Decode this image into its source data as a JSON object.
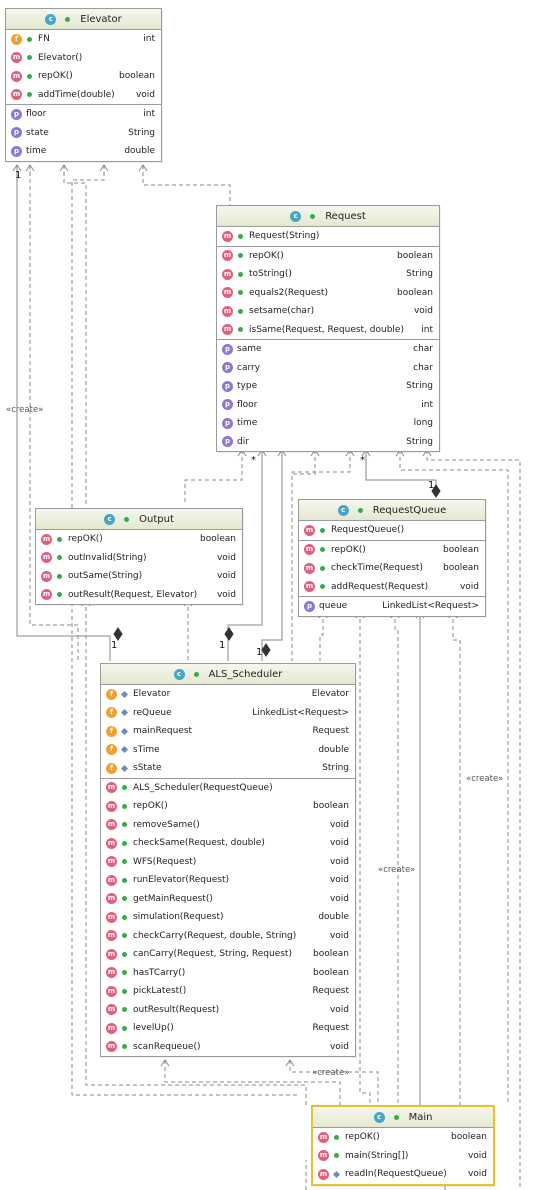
{
  "classes": {
    "elevator": {
      "name": "Elevator",
      "methods": [
        {
          "name": "FN",
          "type": "int",
          "badge": "f",
          "vis": "pub"
        },
        {
          "name": "Elevator()",
          "type": "",
          "badge": "m",
          "vis": "pub"
        },
        {
          "name": "repOK()",
          "type": "boolean",
          "badge": "m",
          "vis": "pub"
        },
        {
          "name": "addTime(double)",
          "type": "void",
          "badge": "m",
          "vis": "pub"
        }
      ],
      "fields": [
        {
          "name": "floor",
          "type": "int",
          "badge": "p",
          "vis": "pub"
        },
        {
          "name": "state",
          "type": "String",
          "badge": "p",
          "vis": "pub"
        },
        {
          "name": "time",
          "type": "double",
          "badge": "p",
          "vis": "pub"
        }
      ]
    },
    "request": {
      "name": "Request",
      "constructors": [
        {
          "name": "Request(String)",
          "type": "",
          "badge": "m",
          "vis": "pub"
        }
      ],
      "methods": [
        {
          "name": "repOK()",
          "type": "boolean",
          "badge": "m",
          "vis": "pub"
        },
        {
          "name": "toString()",
          "type": "String",
          "badge": "m",
          "vis": "pub"
        },
        {
          "name": "equals2(Request)",
          "type": "boolean",
          "badge": "m",
          "vis": "pub"
        },
        {
          "name": "setsame(char)",
          "type": "void",
          "badge": "m",
          "vis": "pub"
        },
        {
          "name": "isSame(Request, Request, double)",
          "type": "int",
          "badge": "m",
          "vis": "pub"
        }
      ],
      "fields": [
        {
          "name": "same",
          "type": "char",
          "badge": "p",
          "vis": "pub"
        },
        {
          "name": "carry",
          "type": "char",
          "badge": "p",
          "vis": "pub"
        },
        {
          "name": "type",
          "type": "String",
          "badge": "p",
          "vis": "pub"
        },
        {
          "name": "floor",
          "type": "int",
          "badge": "p",
          "vis": "pub"
        },
        {
          "name": "time",
          "type": "long",
          "badge": "p",
          "vis": "pub"
        },
        {
          "name": "dir",
          "type": "String",
          "badge": "p",
          "vis": "pub"
        }
      ]
    },
    "output": {
      "name": "Output",
      "methods": [
        {
          "name": "repOK()",
          "type": "boolean",
          "badge": "m",
          "vis": "pub"
        },
        {
          "name": "outInvalid(String)",
          "type": "void",
          "badge": "m",
          "vis": "pub"
        },
        {
          "name": "outSame(String)",
          "type": "void",
          "badge": "m",
          "vis": "pub"
        },
        {
          "name": "outResult(Request, Elevator)",
          "type": "void",
          "badge": "m",
          "vis": "pub"
        }
      ]
    },
    "request_queue": {
      "name": "RequestQueue",
      "constructors": [
        {
          "name": "RequestQueue()",
          "type": "",
          "badge": "m",
          "vis": "pub"
        }
      ],
      "methods": [
        {
          "name": "repOK()",
          "type": "boolean",
          "badge": "m",
          "vis": "pub"
        },
        {
          "name": "checkTime(Request)",
          "type": "boolean",
          "badge": "m",
          "vis": "pub"
        },
        {
          "name": "addRequest(Request)",
          "type": "void",
          "badge": "m",
          "vis": "pub"
        }
      ],
      "fields": [
        {
          "name": "queue",
          "type": "LinkedList<Request>",
          "badge": "p",
          "vis": "pub"
        }
      ]
    },
    "scheduler": {
      "name": "ALS_Scheduler",
      "fields": [
        {
          "name": "Elevator",
          "type": "Elevator",
          "badge": "f",
          "vis": "pkg"
        },
        {
          "name": "reQueue",
          "type": "LinkedList<Request>",
          "badge": "f",
          "vis": "pkg"
        },
        {
          "name": "mainRequest",
          "type": "Request",
          "badge": "f",
          "vis": "pkg"
        },
        {
          "name": "sTime",
          "type": "double",
          "badge": "f",
          "vis": "pkg"
        },
        {
          "name": "sState",
          "type": "String",
          "badge": "f",
          "vis": "pkg"
        }
      ],
      "methods": [
        {
          "name": "ALS_Scheduler(RequestQueue)",
          "type": "",
          "badge": "m",
          "vis": "pub"
        },
        {
          "name": "repOK()",
          "type": "boolean",
          "badge": "m",
          "vis": "pub"
        },
        {
          "name": "removeSame()",
          "type": "void",
          "badge": "m",
          "vis": "pub"
        },
        {
          "name": "checkSame(Request, double)",
          "type": "void",
          "badge": "m",
          "vis": "pub"
        },
        {
          "name": "WFS(Request)",
          "type": "void",
          "badge": "m",
          "vis": "pub"
        },
        {
          "name": "runElevator(Request)",
          "type": "void",
          "badge": "m",
          "vis": "pub"
        },
        {
          "name": "getMainRequest()",
          "type": "void",
          "badge": "m",
          "vis": "pub"
        },
        {
          "name": "simulation(Request)",
          "type": "double",
          "badge": "m",
          "vis": "pub"
        },
        {
          "name": "checkCarry(Request, double, String)",
          "type": "void",
          "badge": "m",
          "vis": "pub"
        },
        {
          "name": "canCarry(Request, String, Request)",
          "type": "boolean",
          "badge": "m",
          "vis": "pub"
        },
        {
          "name": "hasTCarry()",
          "type": "boolean",
          "badge": "m",
          "vis": "pub"
        },
        {
          "name": "pickLatest()",
          "type": "Request",
          "badge": "m",
          "vis": "pub"
        },
        {
          "name": "outResult(Request)",
          "type": "void",
          "badge": "m",
          "vis": "pub"
        },
        {
          "name": "levelUp()",
          "type": "Request",
          "badge": "m",
          "vis": "pub"
        },
        {
          "name": "scanRequeue()",
          "type": "void",
          "badge": "m",
          "vis": "pub"
        }
      ]
    },
    "main": {
      "name": "Main",
      "methods": [
        {
          "name": "repOK()",
          "type": "boolean",
          "badge": "m",
          "vis": "pub"
        },
        {
          "name": "main(String[])",
          "type": "void",
          "badge": "m",
          "vis": "pub"
        },
        {
          "name": "readIn(RequestQueue)",
          "type": "void",
          "badge": "m",
          "vis": "pkg"
        }
      ]
    }
  },
  "labels": {
    "create_left": "«create»",
    "create_right": "«create»",
    "create_mid": "«create»",
    "create_bottom": "«create»",
    "mult_one_a": "1",
    "mult_one_b": "1",
    "mult_one_c": "1",
    "mult_one_d": "1",
    "mult_one_e": "1",
    "mult_star_a": "*",
    "mult_star_b": "*"
  },
  "colors": {
    "line": "#8a8a8a",
    "header_bg": "#e7ebd6",
    "selected_border": "#e9c22a"
  }
}
